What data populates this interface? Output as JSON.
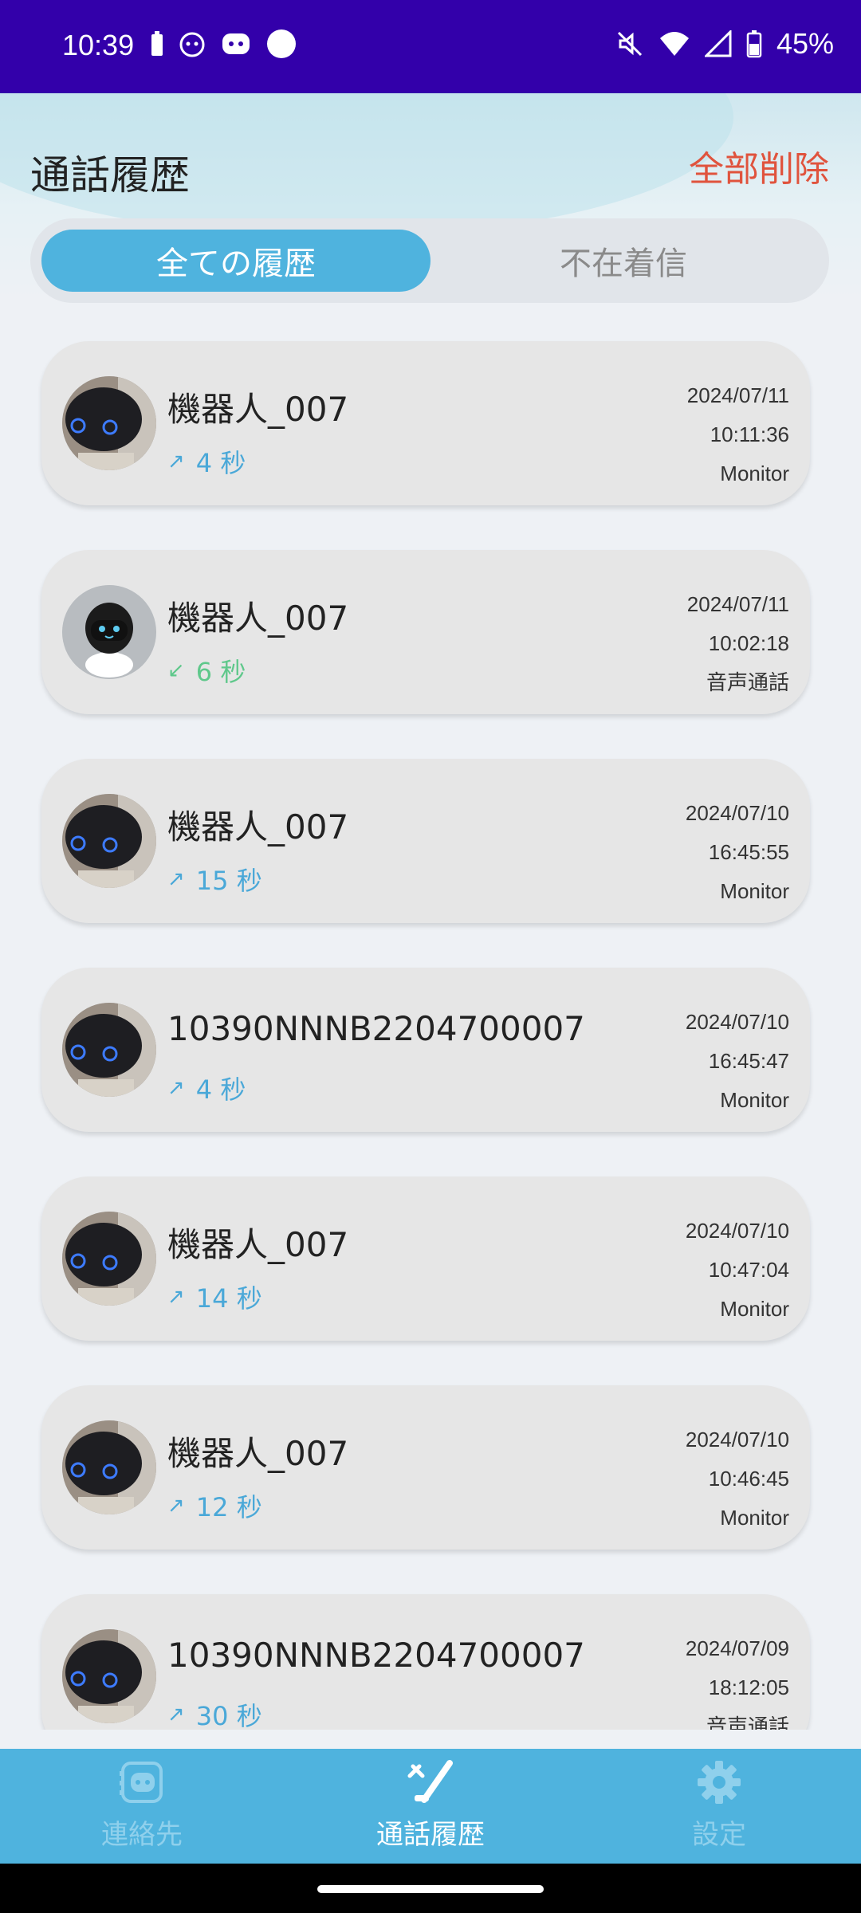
{
  "status_bar": {
    "time": "10:39",
    "battery": "45%"
  },
  "header": {
    "title": "通話履歴",
    "clear_all": "全部削除"
  },
  "tabs": [
    {
      "label": "全ての履歴",
      "selected": true
    },
    {
      "label": "不在着信",
      "selected": false
    }
  ],
  "calls": [
    {
      "name": "機器人_007",
      "direction": "outgoing",
      "arrow": "↗",
      "duration": "4 秒",
      "date": "2024/07/11",
      "time": "10:11:36",
      "type": "Monitor",
      "avatar": "robot-photo"
    },
    {
      "name": "機器人_007",
      "direction": "incoming",
      "arrow": "↙",
      "duration": "6 秒",
      "date": "2024/07/11",
      "time": "10:02:18",
      "type": "音声通話",
      "avatar": "robot-cartoon"
    },
    {
      "name": "機器人_007",
      "direction": "outgoing",
      "arrow": "↗",
      "duration": "15 秒",
      "date": "2024/07/10",
      "time": "16:45:55",
      "type": "Monitor",
      "avatar": "robot-photo"
    },
    {
      "name": "10390NNNB2204700007",
      "direction": "outgoing",
      "arrow": "↗",
      "duration": "4 秒",
      "date": "2024/07/10",
      "time": "16:45:47",
      "type": "Monitor",
      "avatar": "robot-photo"
    },
    {
      "name": "機器人_007",
      "direction": "outgoing",
      "arrow": "↗",
      "duration": "14 秒",
      "date": "2024/07/10",
      "time": "10:47:04",
      "type": "Monitor",
      "avatar": "robot-photo"
    },
    {
      "name": "機器人_007",
      "direction": "outgoing",
      "arrow": "↗",
      "duration": "12 秒",
      "date": "2024/07/10",
      "time": "10:46:45",
      "type": "Monitor",
      "avatar": "robot-photo"
    },
    {
      "name": "10390NNNB2204700007",
      "direction": "outgoing",
      "arrow": "↗",
      "duration": "30 秒",
      "date": "2024/07/09",
      "time": "18:12:05",
      "type": "音声通話",
      "avatar": "robot-photo"
    }
  ],
  "bottom_nav": [
    {
      "label": "連絡先",
      "icon": "contacts-robot-icon",
      "active": false
    },
    {
      "label": "通話履歴",
      "icon": "call-history-icon",
      "active": true
    },
    {
      "label": "設定",
      "icon": "gear-icon",
      "active": false
    }
  ],
  "colors": {
    "accent": "#4fb3de",
    "danger": "#e0533d",
    "status_bar": "#3300aa",
    "outgoing": "#4aa8d8",
    "incoming": "#5fc88b"
  }
}
